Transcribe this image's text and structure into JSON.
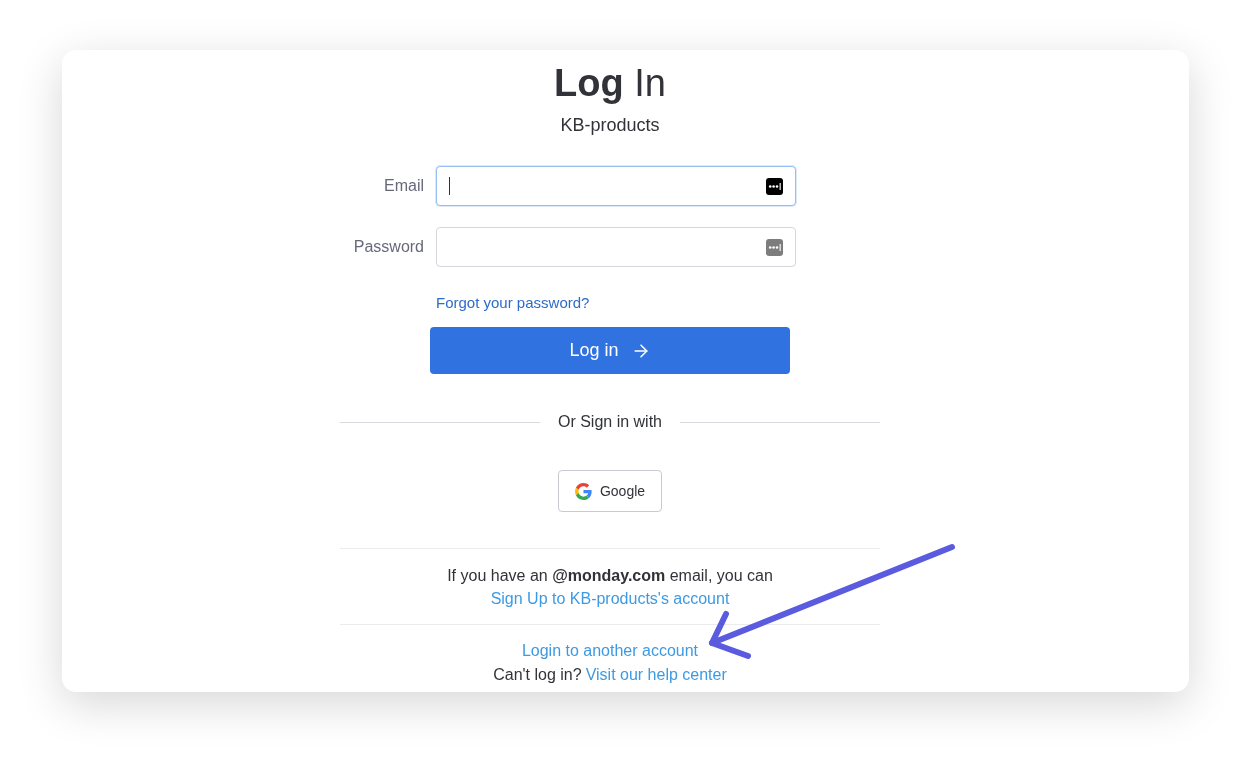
{
  "title": "**Log** In",
  "subtitle": "KB-products",
  "fields": [
    {
      "label": "Email",
      "focused": true
    },
    {
      "label": "Password",
      "focused": false
    }
  ],
  "forgot_link": "Forgot your password?",
  "login_button": {
    "label": "Log in"
  },
  "divider_text": "Or Sign in with",
  "social_buttons": [
    {
      "label": "Google"
    }
  ],
  "signup_note": {
    "text": "If you have an **@monday.com** email, you can",
    "link": "Sign Up to KB-products's account"
  },
  "other_account_link": "Login to another account",
  "help": {
    "text": "Can't log in?",
    "link": "Visit our help center"
  }
}
